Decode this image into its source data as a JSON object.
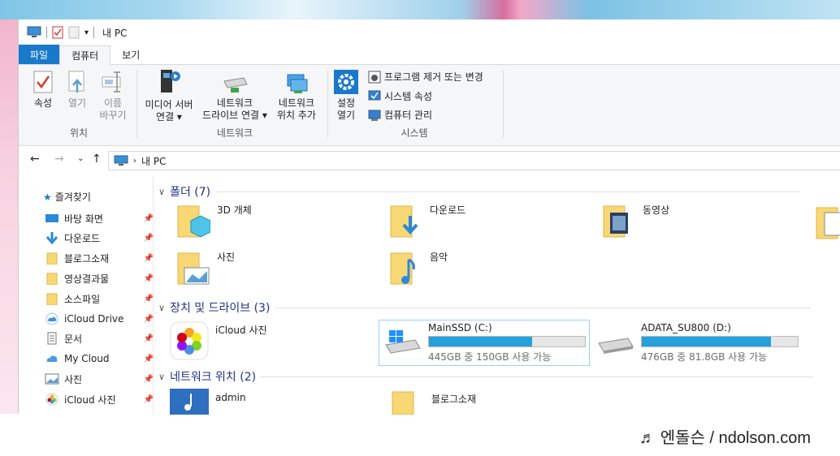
{
  "window": {
    "title": "내 PC"
  },
  "tabs": [
    {
      "label": "파일"
    },
    {
      "label": "컴퓨터"
    },
    {
      "label": "보기"
    }
  ],
  "ribbon": {
    "location": {
      "properties": "속성",
      "open": "열기",
      "rename1": "이름",
      "rename2": "바꾸기",
      "group": "위치"
    },
    "network": {
      "media1": "미디어 서버",
      "media2": "연결 ▾",
      "map1": "네트워크",
      "map2": "드라이브 연결 ▾",
      "add1": "네트워크",
      "add2": "위치 추가",
      "group": "네트워크"
    },
    "system": {
      "settings1": "설정",
      "settings2": "열기",
      "uninstall": "프로그램 제거 또는 변경",
      "sysprops": "시스템 속성",
      "manage": "컴퓨터 관리",
      "group": "시스템"
    }
  },
  "address": {
    "path": "내 PC"
  },
  "sidebar": {
    "quick_access": "즐겨찾기",
    "items": [
      {
        "label": "바탕 화면"
      },
      {
        "label": "다운로드"
      },
      {
        "label": "블로그소재"
      },
      {
        "label": "영상결과물"
      },
      {
        "label": "소스파일"
      },
      {
        "label": "iCloud Drive"
      },
      {
        "label": "문서"
      },
      {
        "label": "My Cloud"
      },
      {
        "label": "사진"
      },
      {
        "label": "iCloud 사진"
      }
    ]
  },
  "folders": {
    "header": "폴더 (7)",
    "items": [
      {
        "label": "3D 개체"
      },
      {
        "label": "다운로드"
      },
      {
        "label": "동영상"
      },
      {
        "label": "사진"
      },
      {
        "label": "음악"
      }
    ]
  },
  "devices": {
    "header": "장치 및 드라이브 (3)",
    "icloud": "iCloud 사진",
    "drives": [
      {
        "name": "MainSSD (C:)",
        "free": "445GB 중 150GB 사용 가능",
        "used_fraction": 0.66
      },
      {
        "name": "ADATA_SU800 (D:)",
        "free": "476GB 중 81.8GB 사용 가능",
        "used_fraction": 0.83
      }
    ]
  },
  "network_locations": {
    "header": "네트워크 위치 (2)",
    "items": [
      {
        "label": "admin"
      },
      {
        "label": "블로그소재"
      }
    ]
  },
  "watermark": "♬ 엔돌슨 / ndolson.com",
  "colors": {
    "accent": "#1979ca",
    "drive_bar": "#26a0da",
    "section_header": "#1e3287"
  }
}
